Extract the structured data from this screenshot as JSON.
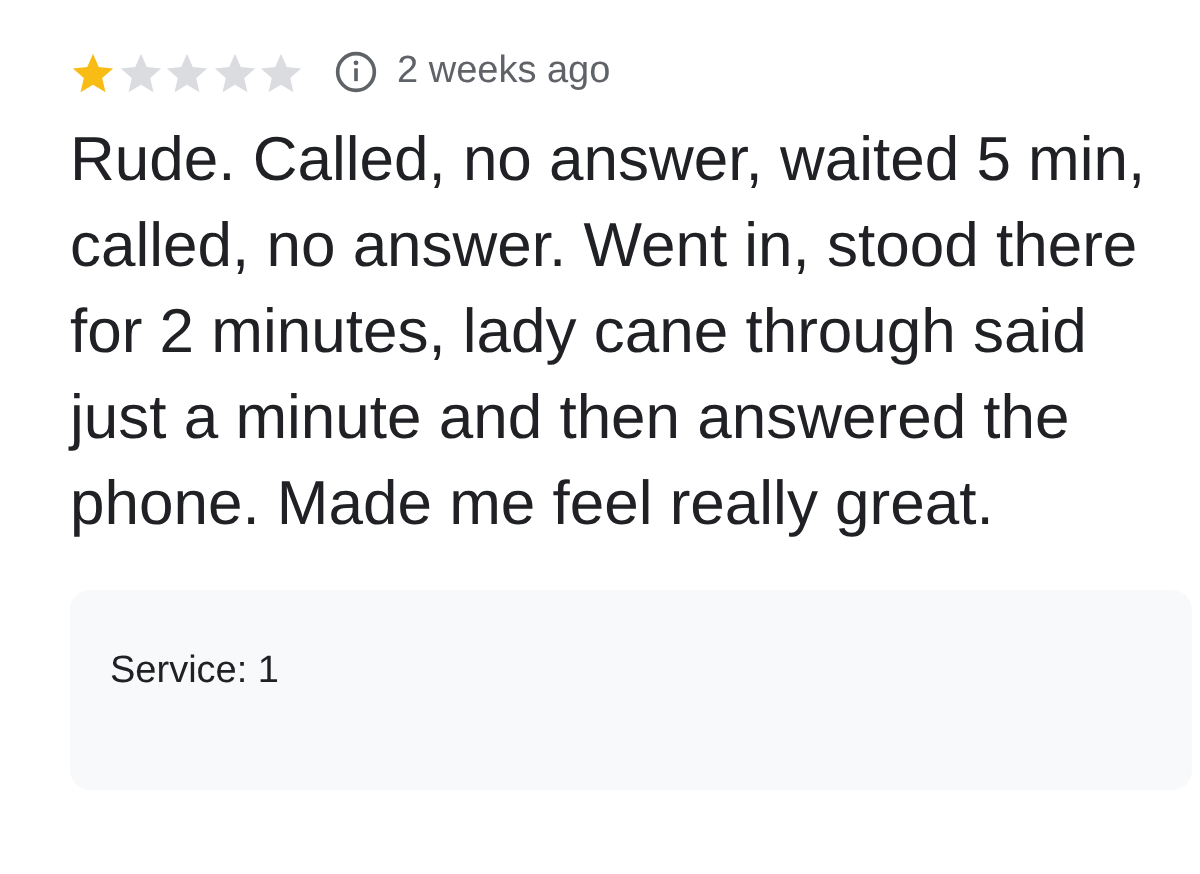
{
  "review": {
    "stars": 1,
    "time": "2 weeks ago",
    "text": "Rude. Called, no answer, waited 5 min, called, no answer. Went in, stood there for 2 minutes, lady cane through said just a minute and then answered the phone. Made me feel really great."
  },
  "ratings": [
    {
      "text": "Service: 1"
    }
  ]
}
